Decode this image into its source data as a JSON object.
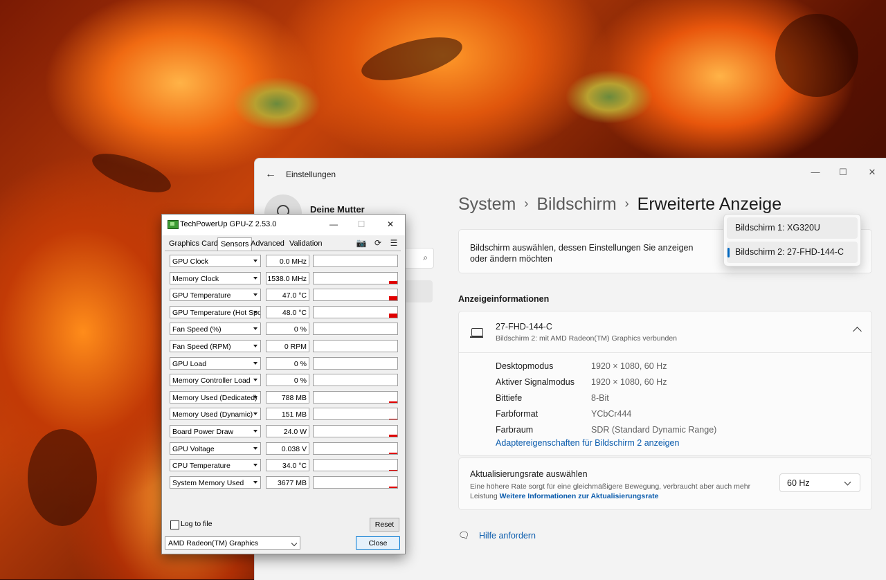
{
  "settings": {
    "app_title": "Einstellungen",
    "user_name": "Deine Mutter",
    "window_controls": {
      "minimize": "—",
      "maximize": "☐",
      "close": "✕"
    },
    "breadcrumb": {
      "part1": "System",
      "part2": "Bildschirm",
      "current": "Erweiterte Anzeige",
      "sep": "›"
    },
    "select_display": {
      "text": "Bildschirm auswählen, dessen Einstellungen Sie anzeigen oder ändern möchten",
      "options": [
        "Bildschirm 1: XG320U",
        "Bildschirm 2: 27-FHD-144-C"
      ],
      "selected": "Bildschirm 2: 27-FHD-144-C"
    },
    "section_title": "Anzeigeinformationen",
    "display_info": {
      "name": "27-FHD-144-C",
      "subtitle": "Bildschirm 2: mit AMD Radeon(TM) Graphics verbunden",
      "rows": [
        {
          "label": "Desktopmodus",
          "value": "1920 × 1080, 60 Hz"
        },
        {
          "label": "Aktiver Signalmodus",
          "value": "1920 × 1080, 60 Hz"
        },
        {
          "label": "Bittiefe",
          "value": "8-Bit"
        },
        {
          "label": "Farbformat",
          "value": "YCbCr444"
        },
        {
          "label": "Farbraum",
          "value": "SDR (Standard Dynamic Range)"
        }
      ],
      "adapter_link": "Adaptereigenschaften für Bildschirm 2 anzeigen"
    },
    "refresh_rate": {
      "title": "Aktualisierungsrate auswählen",
      "desc": "Eine höhere Rate sorgt für eine gleichmäßigere Bewegung, verbraucht aber auch mehr Leistung",
      "link": "Weitere Informationen zur Aktualisierungsrate",
      "value": "60 Hz"
    },
    "help": "Hilfe anfordern"
  },
  "gpuz": {
    "title": "TechPowerUp GPU-Z 2.53.0",
    "window_controls": {
      "minimize": "—",
      "maximize": "☐",
      "close": "✕"
    },
    "tabs": [
      "Graphics Card",
      "Sensors",
      "Advanced",
      "Validation"
    ],
    "active_tab": "Sensors",
    "tools": {
      "camera": "📷",
      "refresh": "⟳",
      "menu": "☰"
    },
    "sensors": [
      {
        "name": "GPU Clock",
        "value": "0.0 MHz",
        "level": 0
      },
      {
        "name": "Memory Clock",
        "value": "1538.0 MHz",
        "level": 0.25
      },
      {
        "name": "GPU Temperature",
        "value": "47.0 °C",
        "level": 0.4
      },
      {
        "name": "GPU Temperature (Hot Spot)",
        "value": "48.0 °C",
        "level": 0.4
      },
      {
        "name": "Fan Speed (%)",
        "value": "0 %",
        "level": 0
      },
      {
        "name": "Fan Speed (RPM)",
        "value": "0 RPM",
        "level": 0
      },
      {
        "name": "GPU Load",
        "value": "0 %",
        "level": 0
      },
      {
        "name": "Memory Controller Load",
        "value": "0 %",
        "level": 0
      },
      {
        "name": "Memory Used (Dedicated)",
        "value": "788 MB",
        "level": 0.1
      },
      {
        "name": "Memory Used (Dynamic)",
        "value": "151 MB",
        "level": 0.05
      },
      {
        "name": "Board Power Draw",
        "value": "24.0 W",
        "level": 0.18
      },
      {
        "name": "GPU Voltage",
        "value": "0.038 V",
        "level": 0.1
      },
      {
        "name": "CPU Temperature",
        "value": "34.0 °C",
        "level": 0.05
      },
      {
        "name": "System Memory Used",
        "value": "3677 MB",
        "level": 0.12
      }
    ],
    "log_label": "Log to file",
    "reset_label": "Reset",
    "device": "AMD Radeon(TM) Graphics",
    "close_label": "Close",
    "bar_color": "#e00000"
  }
}
